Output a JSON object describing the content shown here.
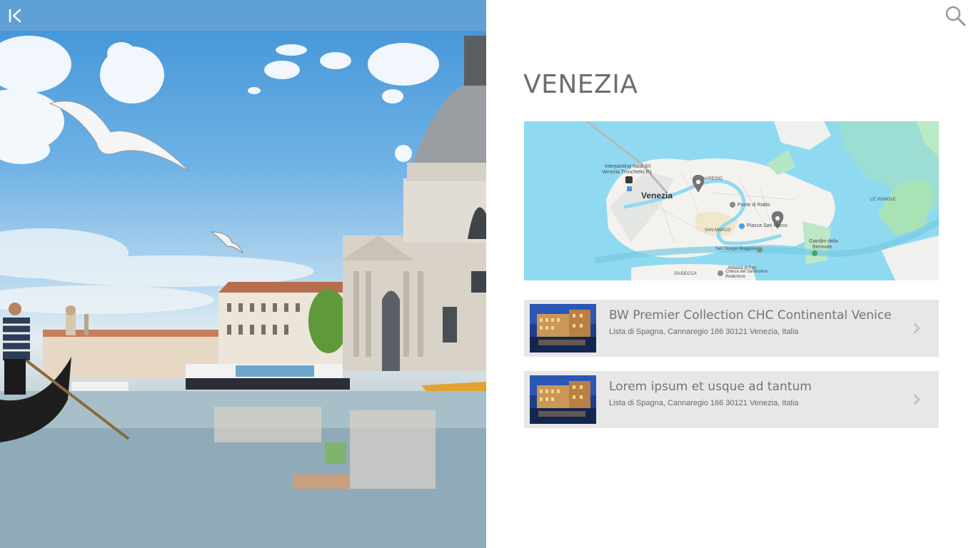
{
  "topbar": {
    "back_icon": "collapse-left-icon"
  },
  "header": {
    "search_icon": "search-icon"
  },
  "page": {
    "title": "VENEZIA"
  },
  "map": {
    "labels": {
      "city": "Venezia",
      "parking": "Interparking Italia Srl",
      "parking2": "Venezia Tronchetto P1",
      "cannaregio": "NAREGIO",
      "rialto": "Ponte di Rialto",
      "sanmarco": "SAN MARCO",
      "piazza": "Piazza San Marco",
      "giorgio": "San Giorgio Maggiore",
      "giardini": "Giardini della",
      "biennale": "Biennale",
      "vignole": "LE VIGNOLE",
      "giudecca": "GIUDECCA",
      "redentore1": "Chiesa del Santissimo",
      "redentore2": "Redentore",
      "abbazia": "Abbazia di San"
    },
    "pins": 2
  },
  "hotels": [
    {
      "name": "BW Premier Collection CHC Continental Venice",
      "address": "Lista di Spagna, Cannaregio 166 30121 Venezia, Italia"
    },
    {
      "name": "Lorem ipsum et usque ad tantum",
      "address": "Lista di Spagna, Cannaregio 166 30121 Venezia, Italia"
    }
  ],
  "colors": {
    "accent": "#6d6d6d",
    "card_bg": "#e7e7e7",
    "map_water": "#8fdaf0"
  }
}
